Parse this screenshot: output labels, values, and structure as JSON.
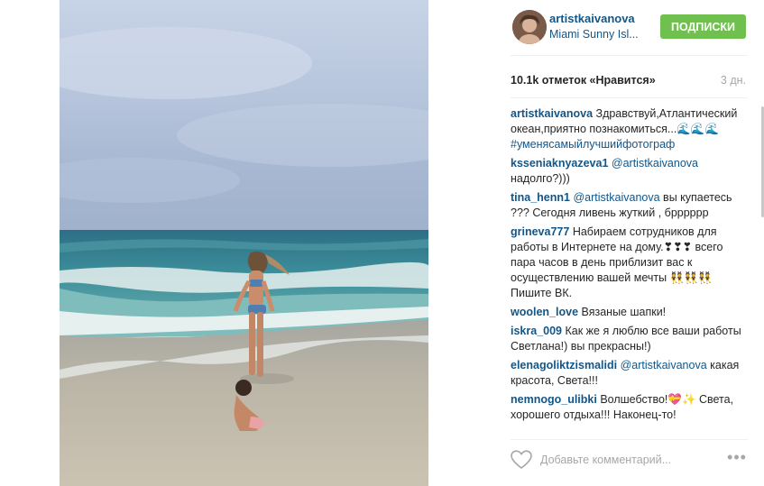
{
  "post": {
    "username": "artistkaivanova",
    "location": "Miami Sunny Isl...",
    "follow_label": "ПОДПИСКИ",
    "likes": "10.1k отметок «Нравится»",
    "time_ago": "3 дн."
  },
  "comments": [
    {
      "user": "artistkaivanova",
      "text": "Здравствуй,Атлантический океан,приятно познакомиться...🌊🌊🌊",
      "hashtag": "#уменясамыйлучшийфотограф",
      "mention": ""
    },
    {
      "user": "ksseniaknyazeva1",
      "mention": "@artistkaivanova",
      "text": "надолго?)))",
      "hashtag": ""
    },
    {
      "user": "tina_henn1",
      "mention": "@artistkaivanova",
      "text": "вы купаетесь ??? Сегодня ливень жуткий , брррррр",
      "hashtag": ""
    },
    {
      "user": "grineva777",
      "mention": "",
      "text": "Набираем сотрудников для работы в Интернете на дому.❣❣❣ всего пара часов в день приблизит вас к осуществлению вашей мечты 👯👯👯 Пишите ВК.",
      "hashtag": ""
    },
    {
      "user": "woolen_love",
      "mention": "",
      "text": "Вязаные шапки!",
      "hashtag": ""
    },
    {
      "user": "iskra_009",
      "mention": "",
      "text": "Как же я люблю все ваши работы Светлана!) вы прекрасны!)",
      "hashtag": ""
    },
    {
      "user": "elenagoliktzismalidi",
      "mention": "@artistkaivanova",
      "text": "какая красота, Света!!!",
      "hashtag": ""
    },
    {
      "user": "nemnogo_ulibki",
      "mention": "",
      "text": "Волшебство!💝✨ Света, хорошего отдыха!!! Наконец-то!",
      "hashtag": ""
    }
  ],
  "comment_input": {
    "placeholder": "Добавьте комментарий..."
  },
  "icons": {
    "like": "heart-icon",
    "more": "more-options-icon",
    "more_glyph": "•••"
  },
  "colors": {
    "link": "#125688",
    "follow_button": "#70c050",
    "muted": "#a5a7aa"
  }
}
